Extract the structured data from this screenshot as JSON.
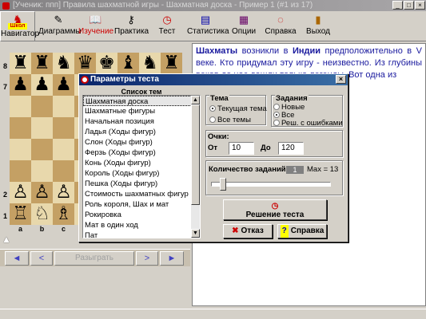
{
  "window": {
    "title": "[Ученик: ппп] Правила шахматной игры - Шахматная доска - Пример 1 (#1 из 17)",
    "controls": [
      "_",
      "□",
      "×"
    ]
  },
  "toolbar": {
    "items": [
      {
        "label": "Навигатор",
        "icon": "logo-icon"
      },
      {
        "label": "Диаграммы",
        "icon": "diagram-icon"
      },
      {
        "label": "Изучение",
        "icon": "book-icon",
        "active": true
      },
      {
        "label": "Практика",
        "icon": "key-icon"
      },
      {
        "label": "Тест",
        "icon": "clock-icon"
      },
      {
        "label": "Статистика",
        "icon": "chart-icon"
      },
      {
        "label": "Опции",
        "icon": "options-icon"
      },
      {
        "label": "Справка",
        "icon": "help-icon"
      },
      {
        "label": "Выход",
        "icon": "exit-icon"
      }
    ],
    "logo_text": "Школ"
  },
  "board": {
    "ranks": [
      "8",
      "7",
      "2",
      "1"
    ],
    "files": [
      "a",
      "b",
      "c"
    ],
    "rows": [
      [
        "♜",
        "♜",
        "♞",
        "♛",
        "♚",
        "♝",
        "♞",
        "♜"
      ],
      [
        "♟",
        "♟",
        "♟",
        "♟",
        "♟",
        "♟",
        "♟",
        "♟"
      ],
      [
        "",
        "",
        "",
        "",
        "",
        "",
        "",
        ""
      ],
      [
        "",
        "",
        "",
        "",
        "",
        "",
        "",
        ""
      ],
      [
        "",
        "",
        "",
        "",
        "",
        "",
        "",
        ""
      ],
      [
        "",
        "",
        "",
        "",
        "",
        "",
        "",
        ""
      ],
      [
        "♙",
        "♙",
        "♙",
        "♙",
        "♙",
        "♙",
        "♙",
        "♙"
      ],
      [
        "♖",
        "♘",
        "♗",
        "♕",
        "♔",
        "♗",
        "♘",
        "♖"
      ]
    ]
  },
  "navbar": {
    "first": "◄",
    "prev": "<",
    "play": "Разыграть",
    "next": ">",
    "last": "►"
  },
  "text": {
    "word1": "Шахматы",
    "middle1": " возникли в ",
    "word2": "Индии",
    "rest": " предположительно в V веке. Кто придумал эту игру - неизвестно. Из глубины веков до нас дошли только легенды. Вот одна из"
  },
  "dialog": {
    "title": "Параметры теста",
    "close": "×",
    "list_header": "Список тем",
    "topics": [
      "Шахматная доска",
      "Шахматные фигуры",
      "Начальная позиция",
      "Ладья (Ходы фигур)",
      "Слон (Ходы фигур)",
      "Ферзь (Ходы фигур)",
      "Конь (Ходы фигур)",
      "Король (Ходы фигур)",
      "Пешка (Ходы фигур)",
      "Стоимость шахматных фигур (Ходы",
      "Роль короля, Шах и мат",
      "Рокировка",
      "Мат в один ход",
      "Пат"
    ],
    "theme_group": {
      "title": "Тема",
      "options": [
        "Текущая тема",
        "Все темы"
      ],
      "selected": 0
    },
    "tasks_group": {
      "title": "Задания",
      "options": [
        "Новые",
        "Все",
        "Реш. с ошибками"
      ],
      "selected": 1
    },
    "points": {
      "title": "Очки:",
      "from_label": "От",
      "from": "10",
      "to_label": "До",
      "to": "120"
    },
    "count": {
      "title": "Количество заданий",
      "value": "1",
      "max": "Max = 13",
      "slider_fraction": 0.08
    },
    "solve_button": "Решение теста",
    "cancel_button": "Отказ",
    "help_button": "Справка"
  }
}
